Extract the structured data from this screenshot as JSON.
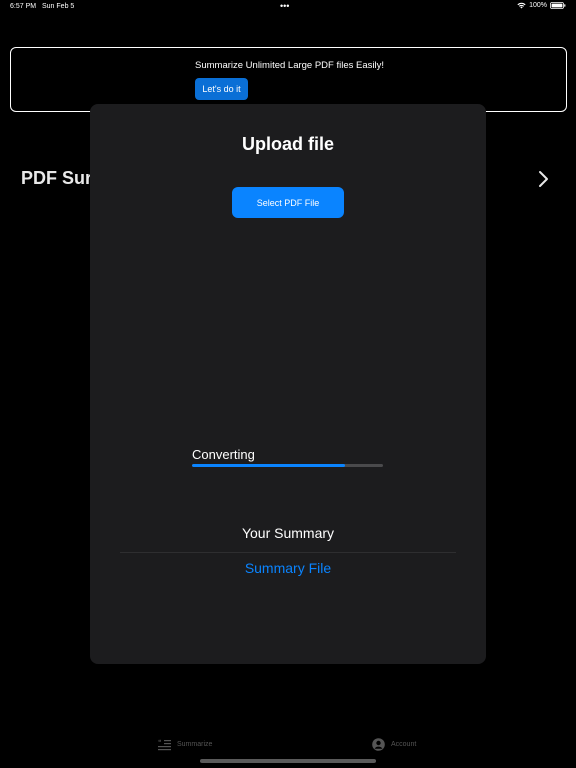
{
  "status_bar": {
    "time": "6:57 PM",
    "date": "Sun Feb 5",
    "dots": "•••",
    "battery": "100%"
  },
  "promo": {
    "text": "Summarize Unlimited Large PDF files Easily!",
    "button_label": "Let's do it"
  },
  "background_row": {
    "title": "PDF Sur"
  },
  "modal": {
    "title": "Upload file",
    "select_button_label": "Select PDF File",
    "progress": {
      "label": "Converting",
      "value": 0.8
    },
    "summary_heading": "Your Summary",
    "summary_link": "Summary File"
  },
  "tab_bar": {
    "items": [
      {
        "label": "Summarize",
        "icon": "summarize-icon"
      },
      {
        "label": "Account",
        "icon": "account-icon"
      }
    ]
  },
  "colors": {
    "accent": "#0a84ff",
    "banner_button": "#0a6fd6",
    "sheet_background": "#1c1c1e",
    "background": "#000000"
  }
}
